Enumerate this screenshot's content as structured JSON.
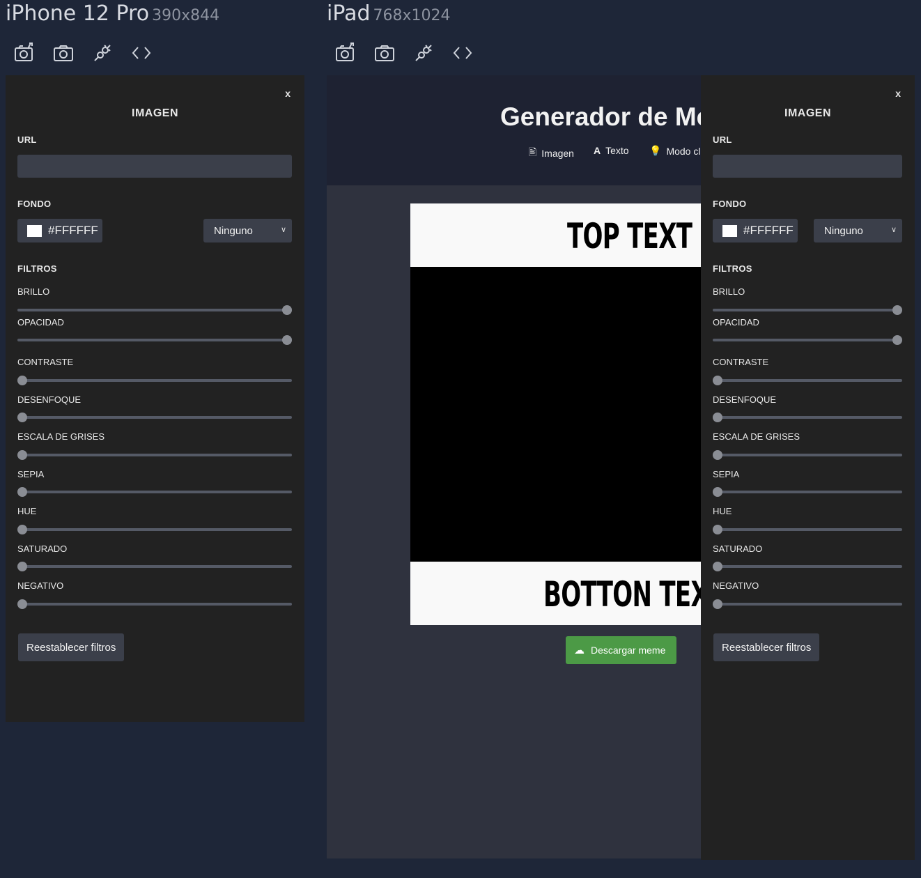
{
  "devices": [
    {
      "name": "iPhone 12 Pro",
      "dims": "390x844"
    },
    {
      "name": "iPad",
      "dims": "768x1024"
    }
  ],
  "toolbar_icons": [
    "camera-retake-icon",
    "camera-icon",
    "plug-disconnect-icon",
    "code-icon"
  ],
  "panel": {
    "close": "x",
    "title": "IMAGEN",
    "url_label": "URL",
    "url_value": "",
    "fondo_label": "FONDO",
    "color_value": "#FFFFFF",
    "blend_select": "Ninguno",
    "filtros_label": "FILTROS",
    "filters": [
      {
        "label": "BRILLO",
        "value": 1.0
      },
      {
        "label": "OPACIDAD",
        "value": 1.0
      },
      {
        "label": "CONTRASTE",
        "value": 0
      },
      {
        "label": "DESENFOQUE",
        "value": 0
      },
      {
        "label": "ESCALA DE GRISES",
        "value": 0
      },
      {
        "label": "SEPIA",
        "value": 0
      },
      {
        "label": "HUE",
        "value": 0
      },
      {
        "label": "SATURADO",
        "value": 0
      },
      {
        "label": "NEGATIVO",
        "value": 0
      }
    ],
    "reset_label": "Reestablecer filtros"
  },
  "app": {
    "title": "Generador de Mer",
    "nav": [
      {
        "label": "Imagen",
        "icon": "file-image-icon"
      },
      {
        "label": "Texto",
        "icon": "font-icon"
      },
      {
        "label": "Modo cla",
        "icon": "lightbulb-icon"
      }
    ],
    "top_text": "TOP TEXT",
    "bottom_text": "BOTTON TEXT",
    "download_label": "Descargar meme"
  },
  "colors": {
    "background": "#1e2638",
    "panel": "#222222",
    "control": "#3b3f4a",
    "download": "#4c9a46"
  }
}
